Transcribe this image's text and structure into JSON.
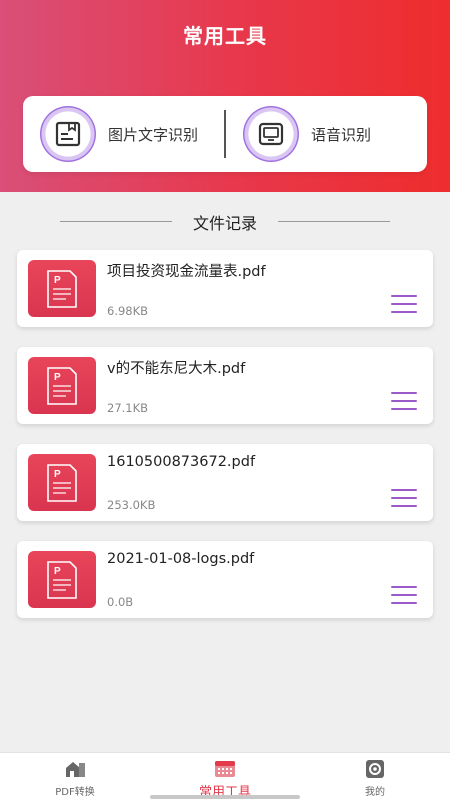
{
  "header": {
    "title": "常用工具"
  },
  "tools": [
    {
      "label": "图片文字识别",
      "icon": "image-text-icon"
    },
    {
      "label": "语音识别",
      "icon": "voice-screen-icon"
    }
  ],
  "section": {
    "title": "文件记录"
  },
  "files": [
    {
      "name": "项目投资现金流量表.pdf",
      "size": "6.98KB"
    },
    {
      "name": "v的不能东尼大木.pdf",
      "size": "27.1KB"
    },
    {
      "name": "1610500873672.pdf",
      "size": "253.0KB"
    },
    {
      "name": "2021-01-08-logs.pdf",
      "size": "0.0B"
    }
  ],
  "tabs": [
    {
      "label": "PDF转换",
      "icon": "house-pdf-icon"
    },
    {
      "label": "常用工具",
      "icon": "toolbox-icon"
    },
    {
      "label": "我的",
      "icon": "gear-icon"
    }
  ],
  "colors": {
    "accent": "#e23a4b",
    "menu": "#9b59c9",
    "header_start": "#d94f78",
    "header_end": "#ee2d2d"
  }
}
